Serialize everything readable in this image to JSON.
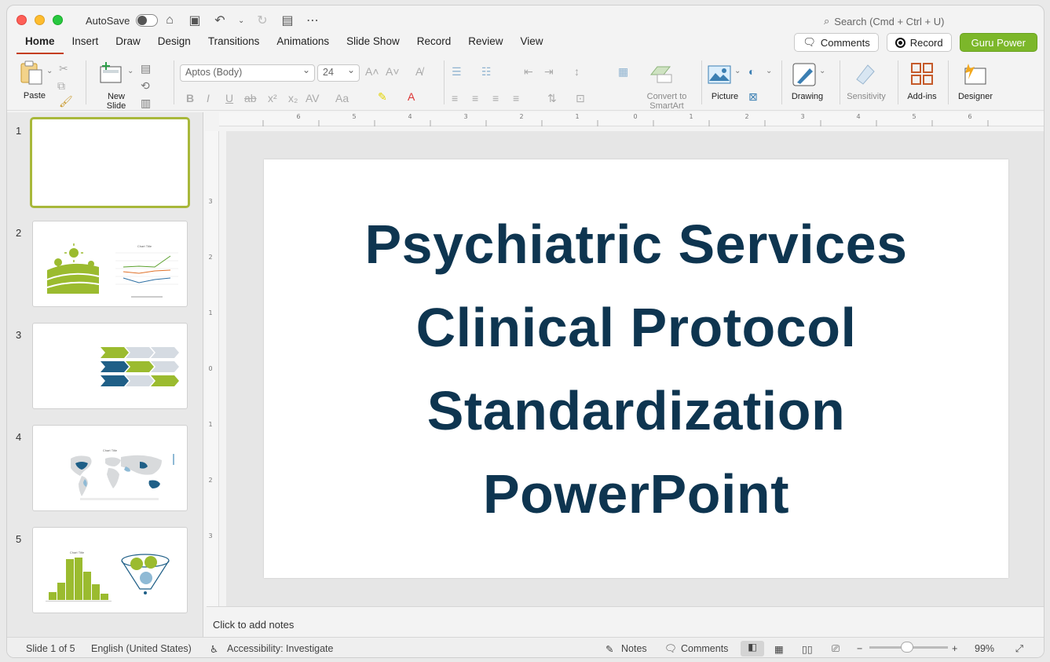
{
  "titlebar": {
    "autosave_label": "AutoSave",
    "search_placeholder": "Search (Cmd + Ctrl + U)"
  },
  "tabs": [
    "Home",
    "Insert",
    "Draw",
    "Design",
    "Transitions",
    "Animations",
    "Slide Show",
    "Record",
    "Review",
    "View"
  ],
  "active_tab": "Home",
  "header_buttons": {
    "comments": "Comments",
    "record": "Record",
    "guru": "Guru Power"
  },
  "ribbon": {
    "paste": "Paste",
    "new_slide": "New Slide",
    "font_name": "Aptos (Body)",
    "font_size": "24",
    "convert_smartart": "Convert to SmartArt",
    "picture": "Picture",
    "drawing": "Drawing",
    "sensitivity": "Sensitivity",
    "addins": "Add-ins",
    "designer": "Designer"
  },
  "thumbnails": [
    {
      "num": "1",
      "kind": "title"
    },
    {
      "num": "2",
      "kind": "landscape-line-chart",
      "chart_title": "Chart Title"
    },
    {
      "num": "3",
      "kind": "chevrons"
    },
    {
      "num": "4",
      "kind": "world-map",
      "chart_title": "Chart Title"
    },
    {
      "num": "5",
      "kind": "histogram-funnel",
      "chart_title": "Chart Title"
    }
  ],
  "slide": {
    "title_lines": [
      "Psychiatric Services",
      "Clinical Protocol",
      "Standardization",
      "PowerPoint"
    ]
  },
  "notes_placeholder": "Click to add notes",
  "status": {
    "slide_counter": "Slide 1 of 5",
    "language": "English (United States)",
    "accessibility": "Accessibility: Investigate",
    "notes": "Notes",
    "comments": "Comments",
    "zoom": "99%"
  },
  "colors": {
    "title_text": "#0e3550",
    "accent_green": "#9bbb2f",
    "accent_blue": "#1f5f87",
    "guru_button": "#7cb72a"
  }
}
